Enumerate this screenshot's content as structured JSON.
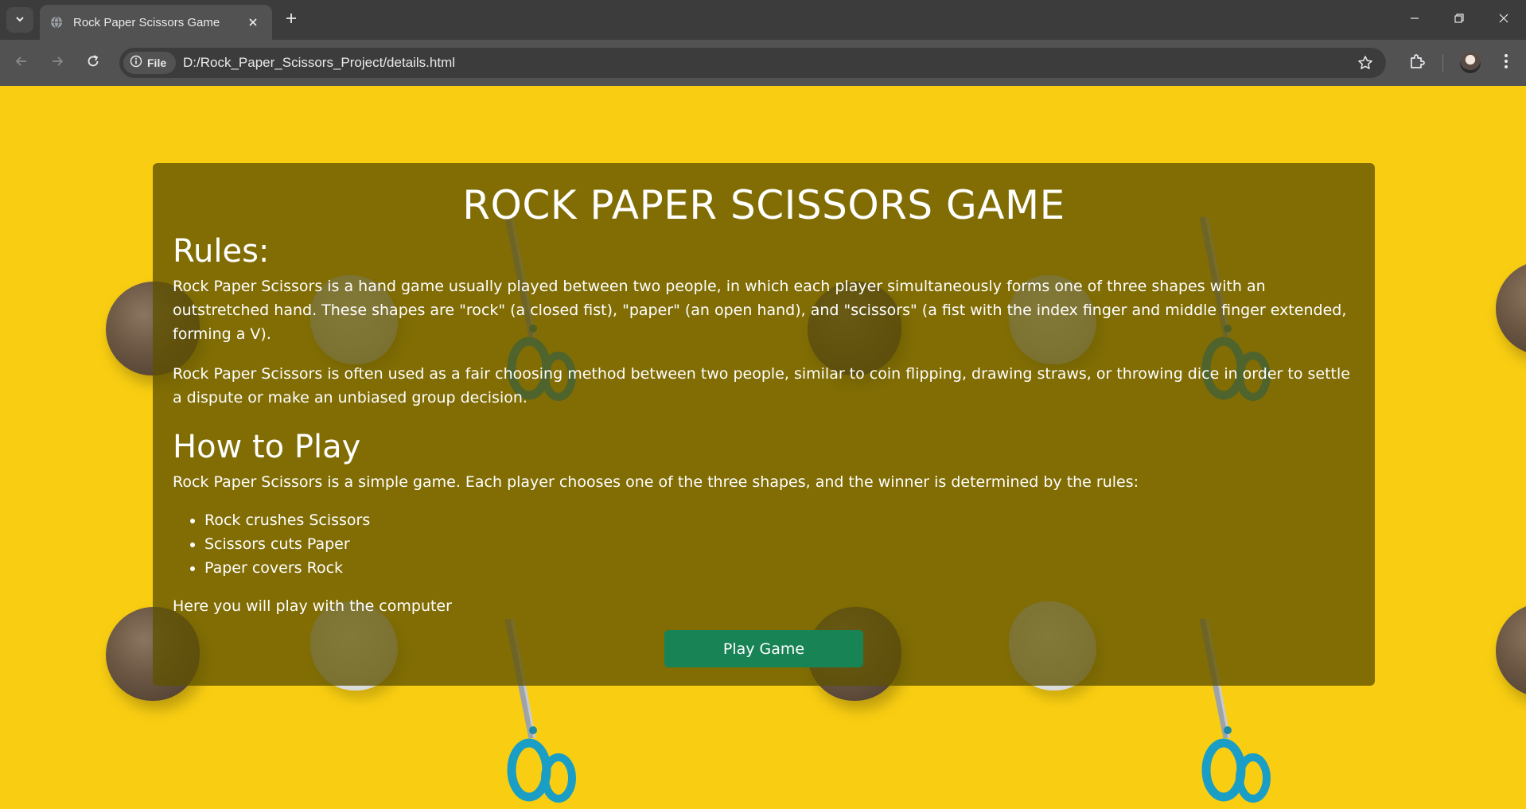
{
  "browser": {
    "tab_title": "Rock Paper Scissors Game",
    "site_chip_label": "File",
    "url": "D:/Rock_Paper_Scissors_Project/details.html"
  },
  "icons": {
    "tab_menu": "chevron-down-icon",
    "favicon": "globe-icon",
    "tab_close": "close-icon",
    "new_tab": "plus-icon",
    "back": "arrow-left-icon",
    "forward": "arrow-right-icon",
    "reload": "reload-icon",
    "site_info": "info-icon",
    "bookmark": "star-icon",
    "extensions": "puzzle-icon",
    "menu": "kebab-menu-icon",
    "minimize": "minimize-icon",
    "restore": "restore-icon",
    "close_window": "close-icon"
  },
  "page": {
    "title": "ROCK PAPER SCISSORS GAME",
    "rules_heading": "Rules:",
    "rules_paragraphs": [
      "Rock Paper Scissors is a hand game usually played between two people, in which each player simultaneously forms one of three shapes with an outstretched hand. These shapes are \"rock\" (a closed fist), \"paper\" (an open hand), and \"scissors\" (a fist with the index finger and middle finger extended, forming a V).",
      "Rock Paper Scissors is often used as a fair choosing method between two people, similar to coin flipping, drawing straws, or throwing dice in order to settle a dispute or make an unbiased group decision."
    ],
    "howto_heading": "How to Play",
    "howto_paragraph": "Rock Paper Scissors is a simple game. Each player chooses one of the three shapes, and the winner is determined by the rules:",
    "outcomes": [
      "Rock crushes Scissors",
      "Scissors cuts Paper",
      "Paper covers Rock"
    ],
    "footer_paragraph": "Here you will play with the computer",
    "play_button": "Play Game"
  },
  "colors": {
    "background": "#f9ce12",
    "card_overlay": "rgba(95, 82, 0, 0.78)",
    "play_button": "#188354",
    "text": "#ffffff"
  }
}
